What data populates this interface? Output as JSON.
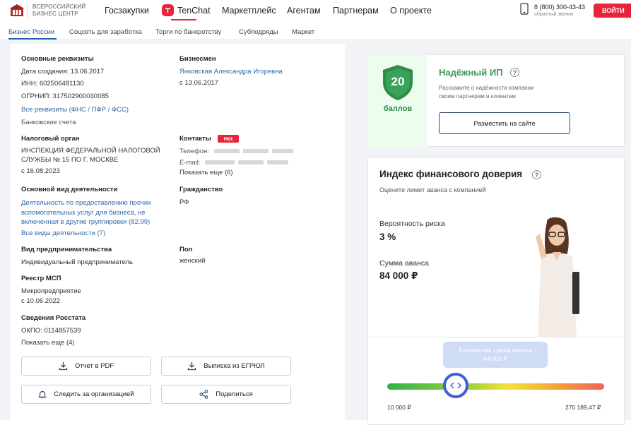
{
  "header": {
    "logo_line1": "ВСЕРОССИЙСКИЙ",
    "logo_line2": "БИЗНЕС ЦЕНТР",
    "nav": [
      "Госзакупки",
      "TenChat",
      "Маркетплейс",
      "Агентам",
      "Партнерам",
      "О проекте"
    ],
    "phone": "8 (800) 300-43-43",
    "phone_sub": "обратный звонок",
    "login": "ВОЙТИ"
  },
  "subnav": [
    "Бизнес России",
    "Соцсеть для заработка",
    "Торги по банкротству",
    "Субподряды",
    "Маркет"
  ],
  "details": {
    "main_title": "Основные реквизиты",
    "created": "Дата создания: 13.06.2017",
    "inn": "ИНН: 602506481130",
    "ogrnip": "ОГРНИП: 317502900030085",
    "all_requisites": "Все реквизиты (ФНС / ПФР / ФСС)",
    "bank_accounts": "Банковские счета",
    "businessman_title": "Бизнесмен",
    "businessman_name": "Янковская Александра Игоревна",
    "businessman_since": "с 13.06.2017",
    "tax_title": "Налоговый орган",
    "tax_line1": "ИНСПЕКЦИЯ ФЕДЕРАЛЬНОЙ НАЛОГОВОЙ",
    "tax_line2": "СЛУЖБЫ № 15 ПО Г. МОСКВЕ",
    "tax_since": "с 16.08.2023",
    "contacts_title": "Контакты",
    "hot": "Hot",
    "phone_label": "Телефон:",
    "email_label": "E-mail:",
    "show_more_6": "Показать еще (6)",
    "activity_title": "Основной вид деятельности",
    "activity_line1": "Деятельность по предоставлению прочих",
    "activity_line2": "вспомогательных услуг для бизнеса, не",
    "activity_line3": "включенная в другие группировки (82.99)",
    "all_activities": "Все виды деятельности (7)",
    "citizenship_title": "Гражданство",
    "citizenship": "РФ",
    "entrepreneur_title": "Вид предпринимательства",
    "entrepreneur": "Индивидуальный предприниматель",
    "gender_title": "Пол",
    "gender": "женский",
    "msp_title": "Реестр МСП",
    "msp": "Микропредприятие",
    "msp_since": "с 10.06.2022",
    "rosstat_title": "Сведения Росстата",
    "okpo": "ОКПО: 0114857539",
    "show_more_4": "Показать еще (4)"
  },
  "buttons": {
    "pdf": "Отчет в PDF",
    "egrul": "Выписка из ЕГРЮЛ",
    "follow": "Следить за организацией",
    "share": "Поделиться"
  },
  "reliability": {
    "score": "20",
    "score_label": "баллов",
    "title": "Надёжный ИП",
    "desc_line1": "Расскажите о надёжности компании",
    "desc_line2": "своим партнерам и клиентам",
    "place_button": "Разместить на сайте"
  },
  "finance": {
    "title": "Индекс финансового доверия",
    "subtitle": "Оцените лимит аванса с компанией",
    "risk_label": "Вероятность риска",
    "risk_value": "3 %",
    "advance_label": "Сумма аванса",
    "advance_value": "84 000 ₽",
    "tooltip_line1": "Безопасная сумма аванса",
    "tooltip_line2": "84 000 ₽",
    "slider_min": "10 000 ₽",
    "slider_max": "270 189,47 ₽",
    "slider_fraction": 0.3
  },
  "colors": {
    "accent_red": "#e8243a",
    "link_blue": "#2e6aa8",
    "green": "#3a9a55",
    "knob_blue": "#3d5ddc"
  }
}
